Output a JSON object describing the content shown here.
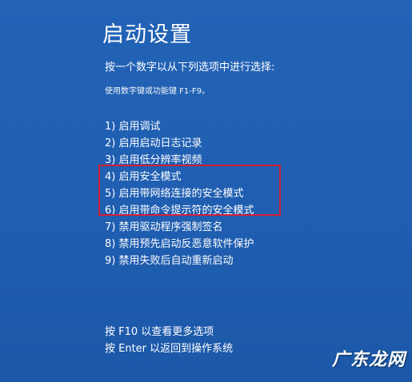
{
  "screen": {
    "title": "启动设置",
    "subtitle": "按一个数字以从下列选项中进行选择:",
    "hint": "使用数字键或功能键 F1-F9。",
    "options": [
      "1) 启用调试",
      "2) 启用启动日志记录",
      "3) 启用低分辨率视频",
      "4) 启用安全模式",
      "5) 启用带网络连接的安全模式",
      "6) 启用带命令提示符的安全模式",
      "7) 禁用驱动程序强制签名",
      "8) 禁用预先启动反恶意软件保护",
      "9) 禁用失败后自动重新启动"
    ],
    "footer": [
      "按 F10 以查看更多选项",
      "按 Enter 以返回到操作系统"
    ]
  },
  "watermark": "广东龙网",
  "colors": {
    "background": "#1f5fb0",
    "text": "#ffffff",
    "highlight_border": "#d2203a"
  }
}
